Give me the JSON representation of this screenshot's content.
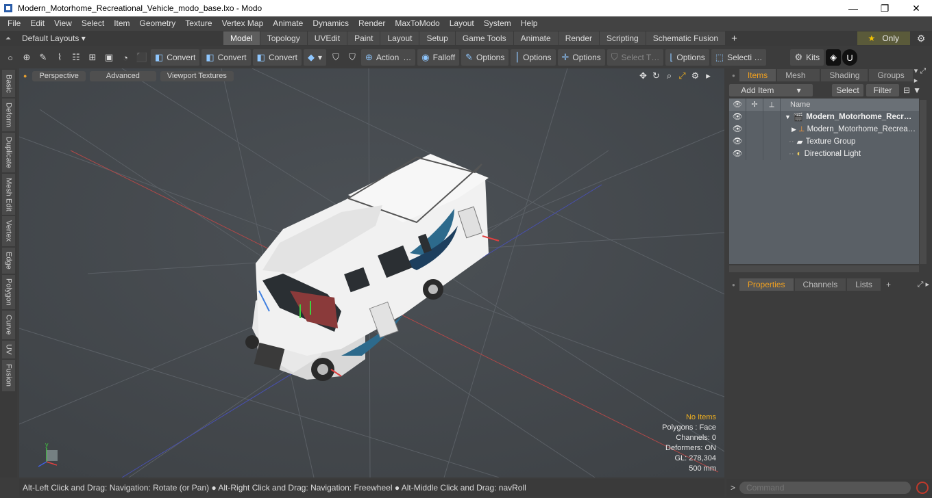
{
  "window": {
    "title": "Modern_Motorhome_Recreational_Vehicle_modo_base.lxo - Modo",
    "minimize": "—",
    "maximize": "❐",
    "close": "✕"
  },
  "menu": [
    "File",
    "Edit",
    "View",
    "Select",
    "Item",
    "Geometry",
    "Texture",
    "Vertex Map",
    "Animate",
    "Dynamics",
    "Render",
    "MaxToModo",
    "Layout",
    "System",
    "Help"
  ],
  "layout_dropdown": "Default Layouts ▾",
  "layout_tabs": [
    "Model",
    "Topology",
    "UVEdit",
    "Paint",
    "Layout",
    "Setup",
    "Game Tools",
    "Animate",
    "Render",
    "Scripting",
    "Schematic Fusion"
  ],
  "active_layout_tab": "Model",
  "only_label": "Only",
  "toolbar": {
    "convert1": "Convert",
    "convert2": "Convert",
    "convert3": "Convert",
    "action": "Action",
    "action_more": "…",
    "falloff": "Falloff",
    "options1": "Options",
    "options2": "Options",
    "options3": "Options",
    "select_t": "Select T…",
    "options4": "Options",
    "selecti": "Selecti …",
    "kits": "Kits"
  },
  "left_tabs": [
    "Basic",
    "Deform",
    "Duplicate",
    "Mesh Edit",
    "Vertex",
    "Edge",
    "Polygon",
    "Curve",
    "UV",
    "Fusion"
  ],
  "viewport": {
    "perspective": "Perspective",
    "advanced": "Advanced",
    "textures": "Viewport Textures",
    "info": {
      "no_items": "No Items",
      "polygons": "Polygons : Face",
      "channels": "Channels: 0",
      "deformers": "Deformers: ON",
      "gl": "GL: 278,304",
      "scale": "500 mm"
    }
  },
  "status": "Alt-Left Click and Drag: Navigation: Rotate (or Pan) ● Alt-Right Click and Drag: Navigation: Freewheel ● Alt-Middle Click and Drag: navRoll",
  "items_panel": {
    "tabs": [
      "Items",
      "Mesh …",
      "Shading",
      "Groups"
    ],
    "add_item": "Add Item",
    "select": "Select",
    "filter": "Filter",
    "name_col": "Name",
    "rows": [
      "Modern_Motorhome_Recr…",
      "Modern_Motorhome_Recrea…",
      "Texture Group",
      "Directional Light"
    ]
  },
  "properties_panel": {
    "tabs": [
      "Properties",
      "Channels",
      "Lists"
    ]
  },
  "command": {
    "placeholder": "Command"
  }
}
